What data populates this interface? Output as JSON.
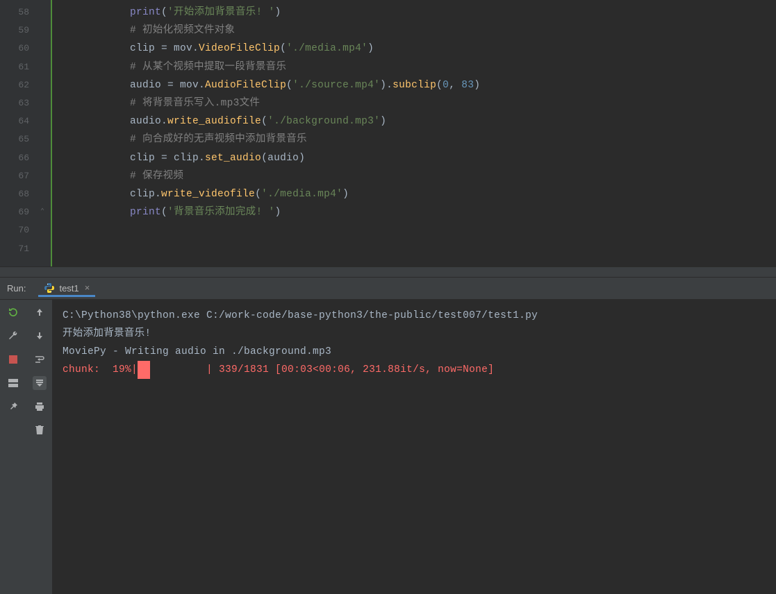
{
  "editor": {
    "lines": [
      {
        "n": "58",
        "tokens": [
          {
            "t": "        ",
            "c": ""
          },
          {
            "t": "print",
            "c": "py-print"
          },
          {
            "t": "(",
            "c": "op"
          },
          {
            "t": "'开始添加背景音乐! '",
            "c": "str"
          },
          {
            "t": ")",
            "c": "op"
          }
        ]
      },
      {
        "n": "59",
        "tokens": [
          {
            "t": "        ",
            "c": ""
          },
          {
            "t": "# 初始化视频文件对象",
            "c": "cmt"
          }
        ]
      },
      {
        "n": "60",
        "tokens": [
          {
            "t": "        ",
            "c": ""
          },
          {
            "t": "clip = mov.",
            "c": "var"
          },
          {
            "t": "VideoFileClip",
            "c": "fn"
          },
          {
            "t": "(",
            "c": "op"
          },
          {
            "t": "'./media.mp4'",
            "c": "str"
          },
          {
            "t": ")",
            "c": "op"
          }
        ]
      },
      {
        "n": "61",
        "tokens": [
          {
            "t": "        ",
            "c": ""
          },
          {
            "t": "# 从某个视频中提取一段背景音乐",
            "c": "cmt"
          }
        ]
      },
      {
        "n": "62",
        "tokens": [
          {
            "t": "        ",
            "c": ""
          },
          {
            "t": "audio = mov.",
            "c": "var"
          },
          {
            "t": "AudioFileClip",
            "c": "fn"
          },
          {
            "t": "(",
            "c": "op"
          },
          {
            "t": "'./source.mp4'",
            "c": "str"
          },
          {
            "t": ").",
            "c": "op"
          },
          {
            "t": "subclip",
            "c": "fn"
          },
          {
            "t": "(",
            "c": "op"
          },
          {
            "t": "0",
            "c": "num"
          },
          {
            "t": ", ",
            "c": "op"
          },
          {
            "t": "83",
            "c": "num"
          },
          {
            "t": ")",
            "c": "op"
          }
        ]
      },
      {
        "n": "63",
        "tokens": [
          {
            "t": "        ",
            "c": ""
          },
          {
            "t": "# 将背景音乐写入.mp3文件",
            "c": "cmt"
          }
        ]
      },
      {
        "n": "64",
        "tokens": [
          {
            "t": "        ",
            "c": ""
          },
          {
            "t": "audio.",
            "c": "var"
          },
          {
            "t": "write_audiofile",
            "c": "fn"
          },
          {
            "t": "(",
            "c": "op"
          },
          {
            "t": "'./background.mp3'",
            "c": "str"
          },
          {
            "t": ")",
            "c": "op"
          }
        ]
      },
      {
        "n": "65",
        "tokens": [
          {
            "t": "        ",
            "c": ""
          },
          {
            "t": "# 向合成好的无声视频中添加背景音乐",
            "c": "cmt"
          }
        ]
      },
      {
        "n": "66",
        "tokens": [
          {
            "t": "        ",
            "c": ""
          },
          {
            "t": "clip = clip.",
            "c": "var"
          },
          {
            "t": "set_audio",
            "c": "fn"
          },
          {
            "t": "(audio)",
            "c": "op"
          }
        ]
      },
      {
        "n": "67",
        "tokens": [
          {
            "t": "        ",
            "c": ""
          },
          {
            "t": "# 保存视频",
            "c": "cmt"
          }
        ]
      },
      {
        "n": "68",
        "tokens": [
          {
            "t": "        ",
            "c": ""
          },
          {
            "t": "clip.",
            "c": "var"
          },
          {
            "t": "write_videofile",
            "c": "fn"
          },
          {
            "t": "(",
            "c": "op"
          },
          {
            "t": "'./media.mp4'",
            "c": "str"
          },
          {
            "t": ")",
            "c": "op"
          }
        ]
      },
      {
        "n": "69",
        "tokens": [
          {
            "t": "        ",
            "c": ""
          },
          {
            "t": "print",
            "c": "py-print"
          },
          {
            "t": "(",
            "c": "op"
          },
          {
            "t": "'背景音乐添加完成! '",
            "c": "str"
          },
          {
            "t": ")",
            "c": "op"
          }
        ]
      },
      {
        "n": "70",
        "tokens": []
      },
      {
        "n": "71",
        "tokens": []
      }
    ]
  },
  "run": {
    "label": "Run:",
    "tab_name": "test1",
    "console": [
      {
        "text": "C:\\Python38\\python.exe C:/work-code/base-python3/the-public/test007/test1.py",
        "cls": ""
      },
      {
        "text": "开始添加背景音乐!",
        "cls": ""
      },
      {
        "text": "MoviePy - Writing audio in ./background.mp3",
        "cls": ""
      },
      {
        "text": "chunk:  19%|",
        "text2": "█",
        "text3": "         | 339/1831 [00:03<00:06, 231.88it/s, now=None]",
        "cls": "console-red"
      }
    ]
  }
}
